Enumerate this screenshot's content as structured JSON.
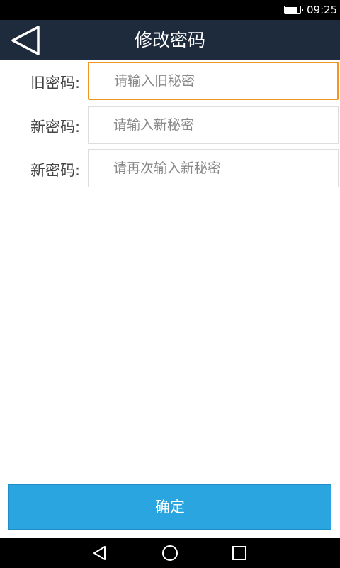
{
  "status_bar": {
    "time": "09:25",
    "battery_icon": "battery-icon",
    "battery_level": 0.75
  },
  "header": {
    "title": "修改密码",
    "back_icon": "back-triangle-icon"
  },
  "form": {
    "old_password": {
      "label": "旧密码:",
      "placeholder": "请输入旧秘密",
      "focused": true
    },
    "new_password": {
      "label": "新密码:",
      "placeholder": "请输入新秘密"
    },
    "confirm_password": {
      "label": "新密码:",
      "placeholder": "请再次输入新秘密"
    }
  },
  "actions": {
    "confirm_label": "确定"
  },
  "nav_bar": {
    "back": "nav-back-icon",
    "home": "nav-home-icon",
    "recent": "nav-recent-icon"
  },
  "colors": {
    "header_bg": "#1e2b3d",
    "accent": "#2aa5df",
    "focus_border": "#f0951f"
  }
}
